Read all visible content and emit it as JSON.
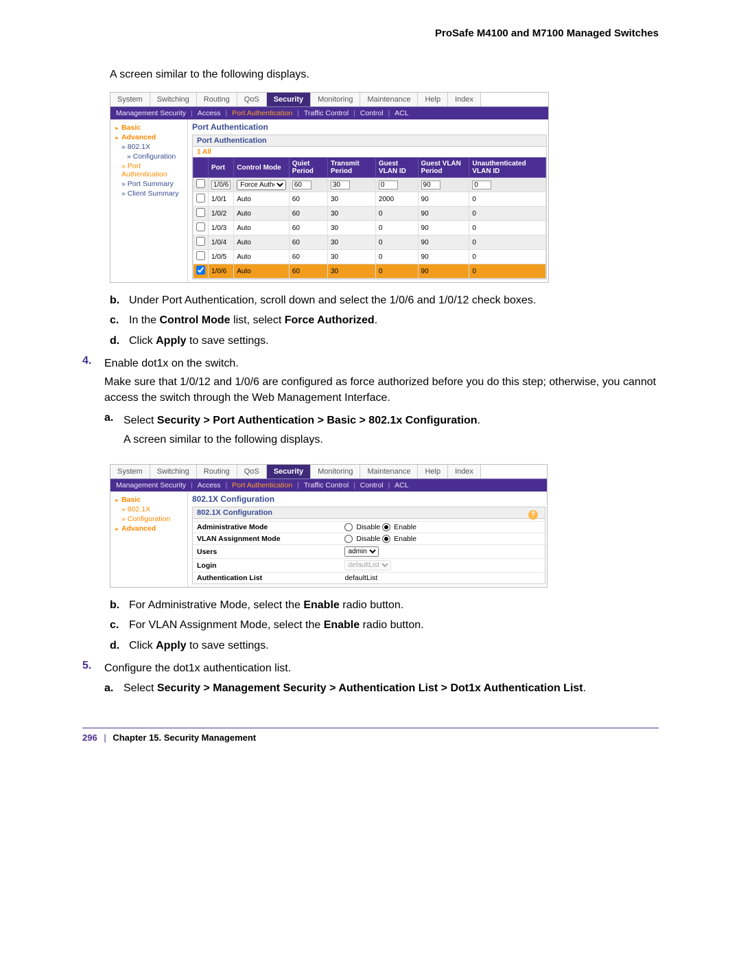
{
  "doc_title": "ProSafe M4100 and M7100 Managed Switches",
  "intro_line": "A screen similar to the following displays.",
  "tabs": [
    "System",
    "Switching",
    "Routing",
    "QoS",
    "Security",
    "Monitoring",
    "Maintenance",
    "Help",
    "Index"
  ],
  "active_tab": "Security",
  "subnav": [
    "Management Security",
    "Access",
    "Port Authentication",
    "Traffic Control",
    "Control",
    "ACL"
  ],
  "subnav_on": "Port Authentication",
  "shot1": {
    "side": {
      "lvl1": [
        "Basic",
        "Advanced"
      ],
      "items": [
        {
          "t": "802.1X",
          "lvl": 2,
          "on": false
        },
        {
          "t": "Configuration",
          "lvl": 3,
          "on": false
        },
        {
          "t": "Port Authentication",
          "lvl": 2,
          "on": true
        },
        {
          "t": "Port Summary",
          "lvl": 2,
          "on": false
        },
        {
          "t": "Client Summary",
          "lvl": 2,
          "on": false
        }
      ]
    },
    "panel_title": "Port Authentication",
    "panel_head": "Port Authentication",
    "filter_row": "1  All",
    "columns": [
      "",
      "Port",
      "Control Mode",
      "Quiet Period",
      "Transmit Period",
      "Guest VLAN ID",
      "Guest VLAN Period",
      "Unauthenticated VLAN ID"
    ],
    "entry_row": {
      "port": "1/0/6",
      "mode": "Force Authorized",
      "quiet": "60",
      "transmit": "30",
      "gvid": "0",
      "gvper": "90",
      "uvid": "0"
    },
    "rows": [
      {
        "port": "1/0/1",
        "mode": "Auto",
        "quiet": "60",
        "transmit": "30",
        "gvid": "2000",
        "gvper": "90",
        "uvid": "0",
        "z": "a"
      },
      {
        "port": "1/0/2",
        "mode": "Auto",
        "quiet": "60",
        "transmit": "30",
        "gvid": "0",
        "gvper": "90",
        "uvid": "0",
        "z": "b"
      },
      {
        "port": "1/0/3",
        "mode": "Auto",
        "quiet": "60",
        "transmit": "30",
        "gvid": "0",
        "gvper": "90",
        "uvid": "0",
        "z": "a"
      },
      {
        "port": "1/0/4",
        "mode": "Auto",
        "quiet": "60",
        "transmit": "30",
        "gvid": "0",
        "gvper": "90",
        "uvid": "0",
        "z": "b"
      },
      {
        "port": "1/0/5",
        "mode": "Auto",
        "quiet": "60",
        "transmit": "30",
        "gvid": "0",
        "gvper": "90",
        "uvid": "0",
        "z": "a"
      },
      {
        "port": "1/0/6",
        "mode": "Auto",
        "quiet": "60",
        "transmit": "30",
        "gvid": "0",
        "gvper": "90",
        "uvid": "0",
        "z": "hl",
        "checked": true
      }
    ]
  },
  "steps_after_shot1": {
    "b": "Under Port Authentication, scroll down and select the 1/0/6 and 1/0/12 check boxes.",
    "c_pre": "In the ",
    "c_b1": "Control Mode",
    "c_mid": " list, select ",
    "c_b2": "Force Authorized",
    "c_post": ".",
    "d_pre": "Click ",
    "d_b": "Apply",
    "d_post": " to save settings."
  },
  "step4": {
    "marker": "4.",
    "line1": "Enable dot1x on the switch.",
    "para": "Make sure that 1/0/12 and 1/0/6 are configured as force authorized before you do this step; otherwise, you cannot access the switch through the Web Management Interface.",
    "a_pre": "Select ",
    "a_b": "Security > Port Authentication > Basic > 802.1x Configuration",
    "a_post": ".",
    "a_line2": "A screen similar to the following displays."
  },
  "shot2": {
    "side": {
      "lvl1a": "Basic",
      "items_a": [
        {
          "t": "802.1X",
          "on": true
        },
        {
          "t": "Configuration",
          "on": true
        }
      ],
      "lvl1b": "Advanced"
    },
    "panel_title": "802.1X Configuration",
    "panel_head": "802.1X Configuration",
    "rows": [
      {
        "label": "Administrative Mode",
        "type": "radio",
        "v": "Enable"
      },
      {
        "label": "VLAN Assignment Mode",
        "type": "radio",
        "v": "Enable"
      },
      {
        "label": "Users",
        "type": "select",
        "v": "admin"
      },
      {
        "label": "Login",
        "type": "select",
        "v": "defaultList",
        "disabled": true
      },
      {
        "label": "Authentication List",
        "type": "text",
        "v": "defaultList"
      }
    ],
    "radio_labels": {
      "off": "Disable",
      "on": "Enable"
    }
  },
  "steps_after_shot2": {
    "b_pre": "For Administrative Mode, select the ",
    "b_b": "Enable",
    "b_post": " radio button.",
    "c_pre": "For VLAN Assignment Mode, select the ",
    "c_b": "Enable",
    "c_post": " radio button.",
    "d_pre": "Click ",
    "d_b": "Apply",
    "d_post": " to save settings."
  },
  "step5": {
    "marker": "5.",
    "line1": "Configure the dot1x authentication list.",
    "a_pre": "Select ",
    "a_b": "Security > Management Security > Authentication List > Dot1x Authentication List",
    "a_post": "."
  },
  "footer": {
    "page": "296",
    "chapter": "Chapter 15.  Security Management"
  }
}
